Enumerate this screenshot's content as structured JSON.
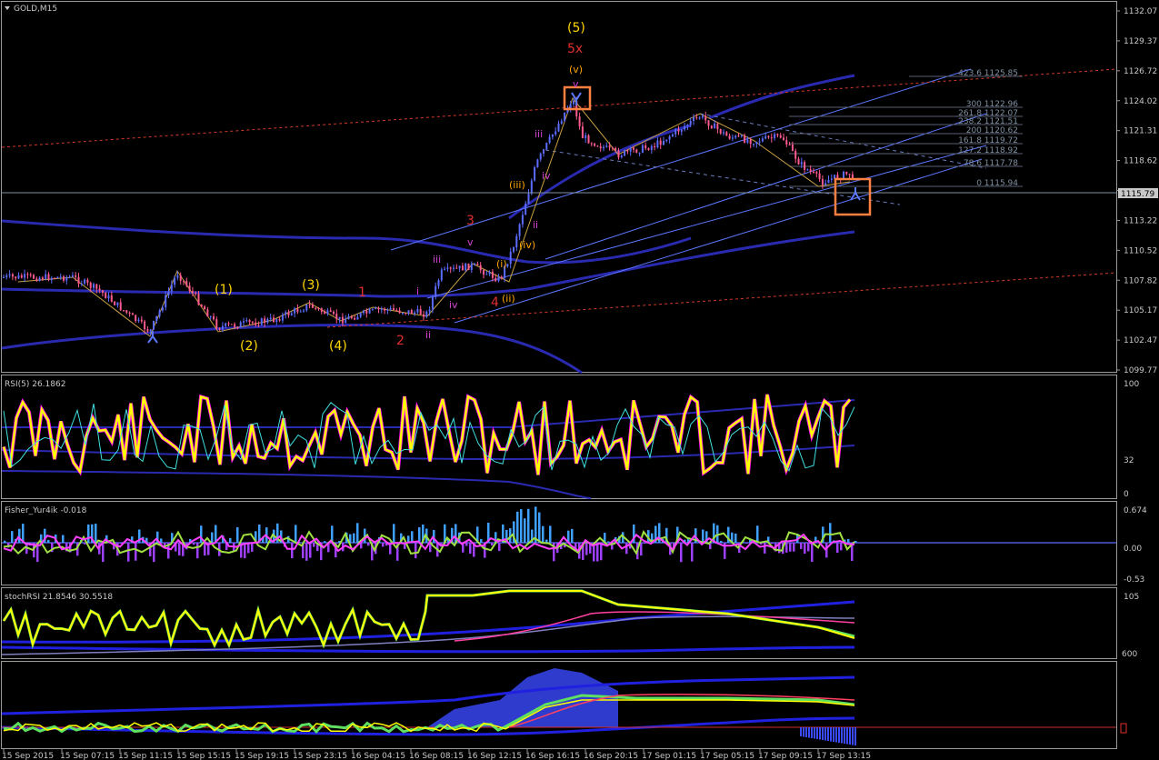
{
  "window": {
    "symbol_label": "GOLD,M15"
  },
  "colors": {
    "background": "#000000",
    "grid_frame": "#9a9a9a",
    "bull_candle": "#5b6cff",
    "bear_candle": "#ff5b8f",
    "envelope": "#2a2ab0",
    "channel": "#5b78ff",
    "red_dash": "#d23a2a",
    "wave_yellow": "#ffd700",
    "wave_red": "#e03030",
    "wave_magenta": "#d040d0",
    "rsi_main": "#ffff00",
    "rsi_shadow": "#ff00ff",
    "highlight_box": "#ff8040"
  },
  "price_axis": {
    "labels": [
      "1132.07",
      "1129.37",
      "1126.72",
      "1124.02",
      "1121.31",
      "1118.62",
      "1115.79",
      "1113.22",
      "1110.52",
      "1107.82",
      "1105.17",
      "1102.47",
      "1099.77"
    ],
    "current_price": "1115.79"
  },
  "time_axis": {
    "labels": [
      "15 Sep 2015",
      "15 Sep 07:15",
      "15 Sep 11:15",
      "15 Sep 15:15",
      "15 Sep 19:15",
      "15 Sep 23:15",
      "16 Sep 04:15",
      "16 Sep 08:15",
      "16 Sep 12:15",
      "16 Sep 16:15",
      "16 Sep 20:15",
      "17 Sep 01:15",
      "17 Sep 05:15",
      "17 Sep 09:15",
      "17 Sep 13:15"
    ]
  },
  "fib_levels": [
    "423.6 1125.85",
    "300 1122.96",
    "261.8 1122.07",
    "238.2 1121.51",
    "200 1120.62",
    "161.8 1119.72",
    "127.2 1118.92",
    "78.6 1117.78",
    "0 1115.94"
  ],
  "wave_labels": {
    "five_paren": "(5)",
    "five_x": "5x",
    "v_paren": "(v)",
    "v_top": "v",
    "one_paren": "(1)",
    "two_paren": "(2)",
    "three_paren": "(3)",
    "four_paren": "(4)",
    "one": "1",
    "two": "2",
    "three": "3",
    "four": "4",
    "iii_paren": "(iii)",
    "iv_paren": "(iv)",
    "i_paren": "(i)",
    "ii_paren": "(ii)",
    "iii_a": "iii",
    "iii_b": "iii",
    "iv": "iv",
    "iv_b": "iv",
    "i": "i",
    "ii": "ii",
    "ii_b": "ii",
    "v_mid": "v"
  },
  "indicators": {
    "rsi": {
      "label": "RSI(5) 26.1862",
      "levels": [
        "100",
        "32",
        "0"
      ]
    },
    "fisher": {
      "label": "Fisher_Yur4ik -0.018",
      "levels": [
        "0.674",
        "0.00",
        "-0.53"
      ]
    },
    "stochrsi": {
      "label": "stochRSI 21.8546 30.5518",
      "levels": [
        "105",
        "600"
      ]
    }
  },
  "chart_data": {
    "type": "line",
    "title": "GOLD,M15",
    "ylim": [
      1099.77,
      1132.07
    ],
    "x": [
      "15 Sep 2015",
      "15 Sep 07:15",
      "15 Sep 11:15",
      "15 Sep 15:15",
      "15 Sep 19:15",
      "15 Sep 23:15",
      "16 Sep 04:15",
      "16 Sep 08:15",
      "16 Sep 12:15",
      "16 Sep 16:15",
      "16 Sep 20:15",
      "17 Sep 01:15",
      "17 Sep 05:15",
      "17 Sep 09:15",
      "17 Sep 13:15"
    ],
    "series": [
      {
        "values": [
          1108.0,
          1107.5,
          1103.5,
          1104.5,
          1105.5,
          1105.0,
          1105.0,
          1107.0,
          1111.0,
          1123.0,
          1119.5,
          1120.0,
          1121.0,
          1118.0,
          1115.8
        ]
      }
    ],
    "current_price": 1115.79,
    "grid": false
  }
}
